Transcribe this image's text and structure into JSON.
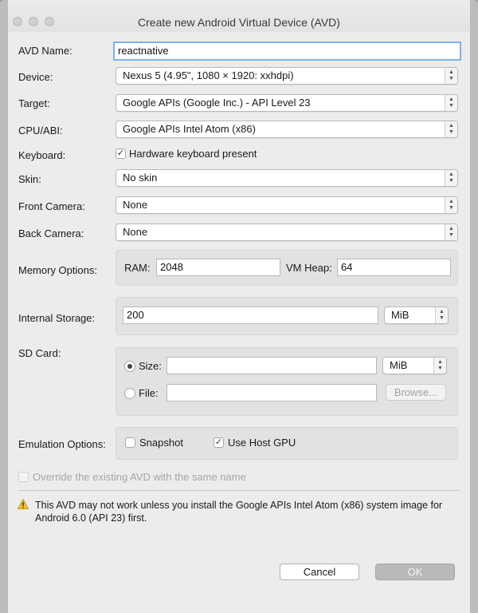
{
  "window": {
    "title": "Create new Android Virtual Device (AVD)"
  },
  "form": {
    "avd_name": {
      "label": "AVD Name:",
      "value": "reactnative"
    },
    "device": {
      "label": "Device:",
      "value": "Nexus 5 (4.95\", 1080 × 1920: xxhdpi)"
    },
    "target": {
      "label": "Target:",
      "value": "Google APIs (Google Inc.) - API Level 23"
    },
    "cpu_abi": {
      "label": "CPU/ABI:",
      "value": "Google APIs Intel Atom (x86)"
    },
    "keyboard": {
      "label": "Keyboard:",
      "checkbox_label": "Hardware keyboard present",
      "checked": true
    },
    "skin": {
      "label": "Skin:",
      "value": "No skin"
    },
    "front_camera": {
      "label": "Front Camera:",
      "value": "None"
    },
    "back_camera": {
      "label": "Back Camera:",
      "value": "None"
    },
    "memory": {
      "label": "Memory Options:",
      "ram_label": "RAM:",
      "ram_value": "2048",
      "vmheap_label": "VM Heap:",
      "vmheap_value": "64"
    },
    "internal_storage": {
      "label": "Internal Storage:",
      "value": "200",
      "unit": "MiB"
    },
    "sd_card": {
      "label": "SD Card:",
      "size_label": "Size:",
      "size_value": "",
      "size_unit": "MiB",
      "file_label": "File:",
      "file_value": "",
      "browse_label": "Browse...",
      "selected": "size"
    },
    "emulation": {
      "label": "Emulation Options:",
      "snapshot_label": "Snapshot",
      "snapshot_checked": false,
      "host_gpu_label": "Use Host GPU",
      "host_gpu_checked": true
    },
    "override": {
      "label": "Override the existing AVD with the same name",
      "checked": false
    }
  },
  "warning": {
    "text_line1": "This AVD may not work unless you install the Google APIs Intel Atom (x86) system image for",
    "text_line2": "Android 6.0 (API 23) first."
  },
  "buttons": {
    "cancel": "Cancel",
    "ok": "OK"
  },
  "icons": {
    "check": "✓",
    "warning": "warning-triangle-icon"
  },
  "colors": {
    "focus_ring": "#7fb0ea",
    "warning_fill": "#f2c230"
  }
}
